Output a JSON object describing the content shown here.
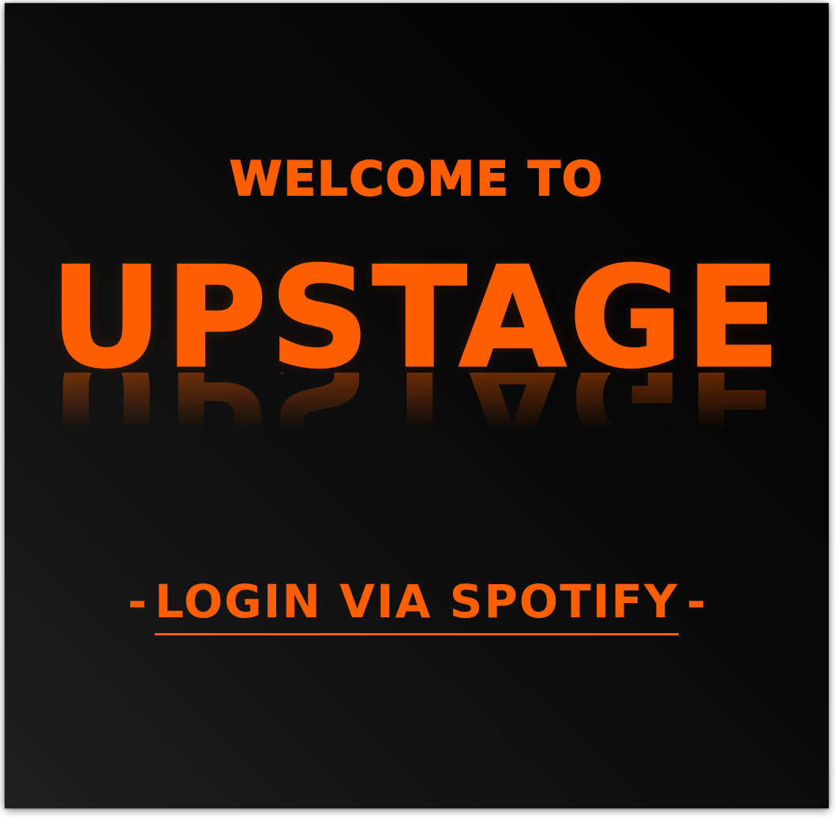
{
  "welcome": {
    "kicker": "Welcome to",
    "title": "UPSTAGE"
  },
  "login": {
    "prefix_dash": "-",
    "link_label": "Login via Spotify",
    "suffix_dash": "-"
  },
  "colors": {
    "accent": "#ff5f00",
    "background_top": "#000000",
    "background_bottom": "#1f1f1f"
  }
}
